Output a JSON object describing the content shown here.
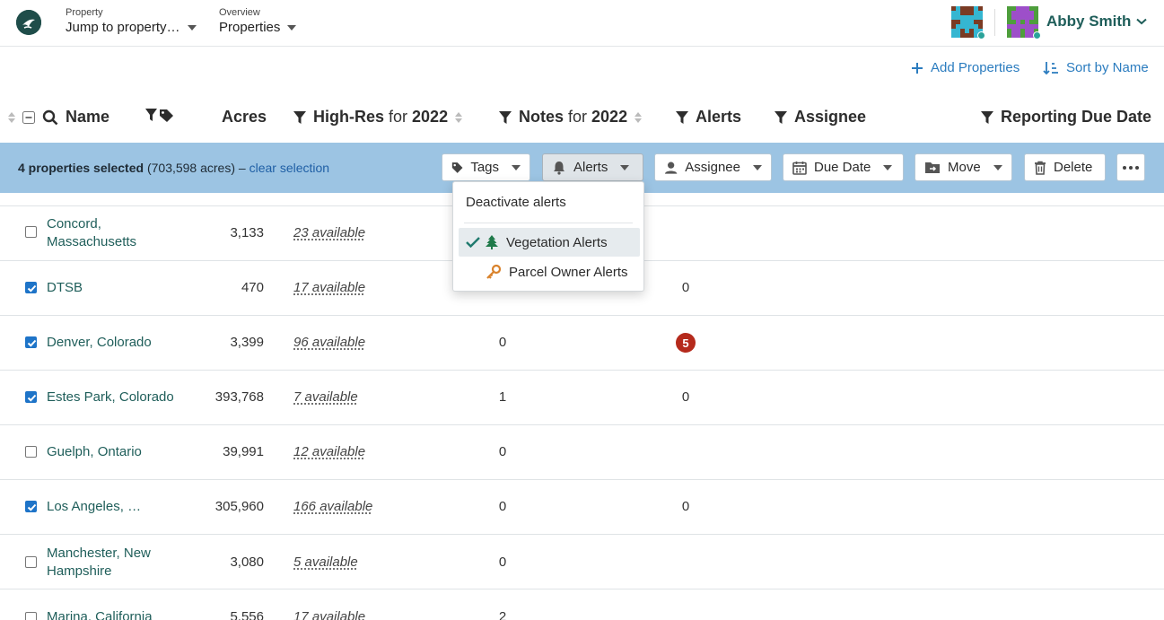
{
  "topbar": {
    "property_small": "Property",
    "property_main": "Jump to property…",
    "overview_small": "Overview",
    "overview_main": "Properties",
    "user_name": "Abby Smith"
  },
  "actions": {
    "add": "Add Properties",
    "sort": "Sort by Name"
  },
  "columns": {
    "name": "Name",
    "acres": "Acres",
    "hires_label": "High-Res",
    "hires_for": "for",
    "hires_year": "2022",
    "notes_label": "Notes",
    "notes_for": "for",
    "notes_year": "2022",
    "alerts": "Alerts",
    "assignee": "Assignee",
    "due": "Reporting Due Date"
  },
  "selection": {
    "count_text": "4 properties selected",
    "acres_text": "(703,598 acres) –",
    "clear": "clear selection",
    "buttons": {
      "tags": "Tags",
      "alerts": "Alerts",
      "assignee": "Assignee",
      "due": "Due Date",
      "move": "Move",
      "delete": "Delete"
    }
  },
  "dropdown": {
    "deactivate": "Deactivate alerts",
    "vegetation": "Vegetation Alerts",
    "parcel": "Parcel Owner Alerts"
  },
  "rows": [
    {
      "name1": "Concord,",
      "name2": "Massachusetts",
      "checked": false,
      "acres": "3,133",
      "hires": "23 available",
      "notes": "",
      "alerts": ""
    },
    {
      "name1": "DTSB",
      "name2": "",
      "checked": true,
      "acres": "470",
      "hires": "17 available",
      "notes": "",
      "alerts": "0"
    },
    {
      "name1": "Denver, Colorado",
      "name2": "",
      "checked": true,
      "acres": "3,399",
      "hires": "96 available",
      "notes": "0",
      "alerts": "5"
    },
    {
      "name1": "Estes Park, Colorado",
      "name2": "",
      "checked": true,
      "acres": "393,768",
      "hires": "7 available",
      "notes": "1",
      "alerts": "0"
    },
    {
      "name1": "Guelph, Ontario",
      "name2": "",
      "checked": false,
      "acres": "39,991",
      "hires": "12 available",
      "notes": "0",
      "alerts": ""
    },
    {
      "name1": "Los Angeles, …",
      "name2": "",
      "checked": true,
      "acres": "305,960",
      "hires": "166 available",
      "notes": "0",
      "alerts": "0"
    },
    {
      "name1": "Manchester, New",
      "name2": "Hampshire",
      "checked": false,
      "acres": "3,080",
      "hires": "5 available",
      "notes": "0",
      "alerts": ""
    },
    {
      "name1": "Marina, California",
      "name2": "",
      "checked": false,
      "acres": "5,556",
      "hires": "17 available",
      "notes": "2",
      "alerts": ""
    }
  ],
  "colors": {
    "selection_bar": "#9cc4e3",
    "link": "#2b7cbf",
    "property_name": "#1f5e5a",
    "alert_badge": "#b52a1c",
    "checkbox_checked": "#1e74c8"
  }
}
